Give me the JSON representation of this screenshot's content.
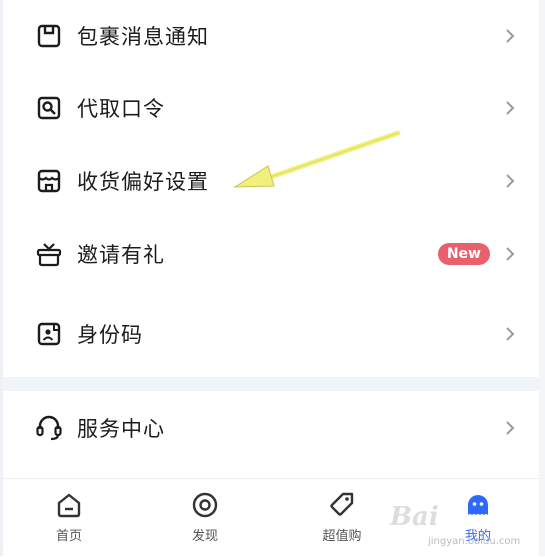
{
  "menu": [
    {
      "label": "包裹消息通知",
      "icon": "package-icon"
    },
    {
      "label": "代取口令",
      "icon": "search-card-icon"
    },
    {
      "label": "收货偏好设置",
      "icon": "storefront-icon"
    },
    {
      "label": "邀请有礼",
      "icon": "gift-box-icon",
      "badge": "New"
    },
    {
      "label": "身份码",
      "icon": "id-code-icon"
    },
    {
      "label": "服务中心",
      "icon": "headset-icon"
    }
  ],
  "tabs": [
    {
      "label": "首页",
      "icon": "home-icon"
    },
    {
      "label": "发现",
      "icon": "discover-icon"
    },
    {
      "label": "超值购",
      "icon": "tag-icon"
    },
    {
      "label": "我的",
      "icon": "profile-icon",
      "active": true
    }
  ],
  "watermark": {
    "logo": "Bai",
    "url": "jingyan.baidu.com"
  },
  "colors": {
    "accent": "#2e69ff",
    "badge": "#e8606b",
    "arrow": "#f2f07a",
    "text": "#1c1c1c"
  }
}
